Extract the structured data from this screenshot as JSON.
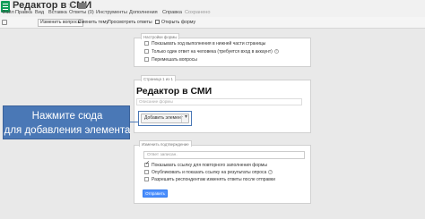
{
  "app": {
    "title": "Редактор в СМИ"
  },
  "menu": [
    "Файл",
    "Правка",
    "Вид",
    "Вставка",
    "Ответы (0)",
    "Инструменты",
    "Дополнения",
    "Справка",
    "Сохранено"
  ],
  "toolbar": {
    "change_questions": "Изменить вопросы",
    "change_theme": "Сменить тему",
    "view_responses": "Просмотреть ответы",
    "open_form": "Открыть форму"
  },
  "settings": {
    "tab_label": "Настройки формы",
    "options": [
      {
        "label": "Показывать ход выполнения в нижней части страницы",
        "checked": false
      },
      {
        "label": "Только один ответ на человека (требуется вход в аккаунт)",
        "checked": false
      },
      {
        "label": "Перемешать вопросы",
        "checked": false
      }
    ]
  },
  "page": {
    "tab_label": "Страница 1 из 1",
    "form_title": "Редактор в СМИ",
    "form_description_placeholder": "Описание формы",
    "add_item_button": "Добавить элемент"
  },
  "callout": {
    "line1": "Нажмите сюда",
    "line2": "для добавления элемента",
    "color": "#4a78b6"
  },
  "confirmation": {
    "tab_label": "Изменить подтверждение",
    "input_placeholder": "Ответ записан.",
    "options": [
      {
        "label": "Показывать ссылку для повторного заполнения формы",
        "checked": true
      },
      {
        "label": "Опубликовать и показать ссылку на результаты опроса",
        "checked": false
      },
      {
        "label": "Разрешить респондентам изменять ответы после отправки",
        "checked": false
      }
    ],
    "submit_button": "Отправить"
  },
  "colors": {
    "accent": "#4d90fe",
    "doc_icon": "#0f9d58"
  }
}
